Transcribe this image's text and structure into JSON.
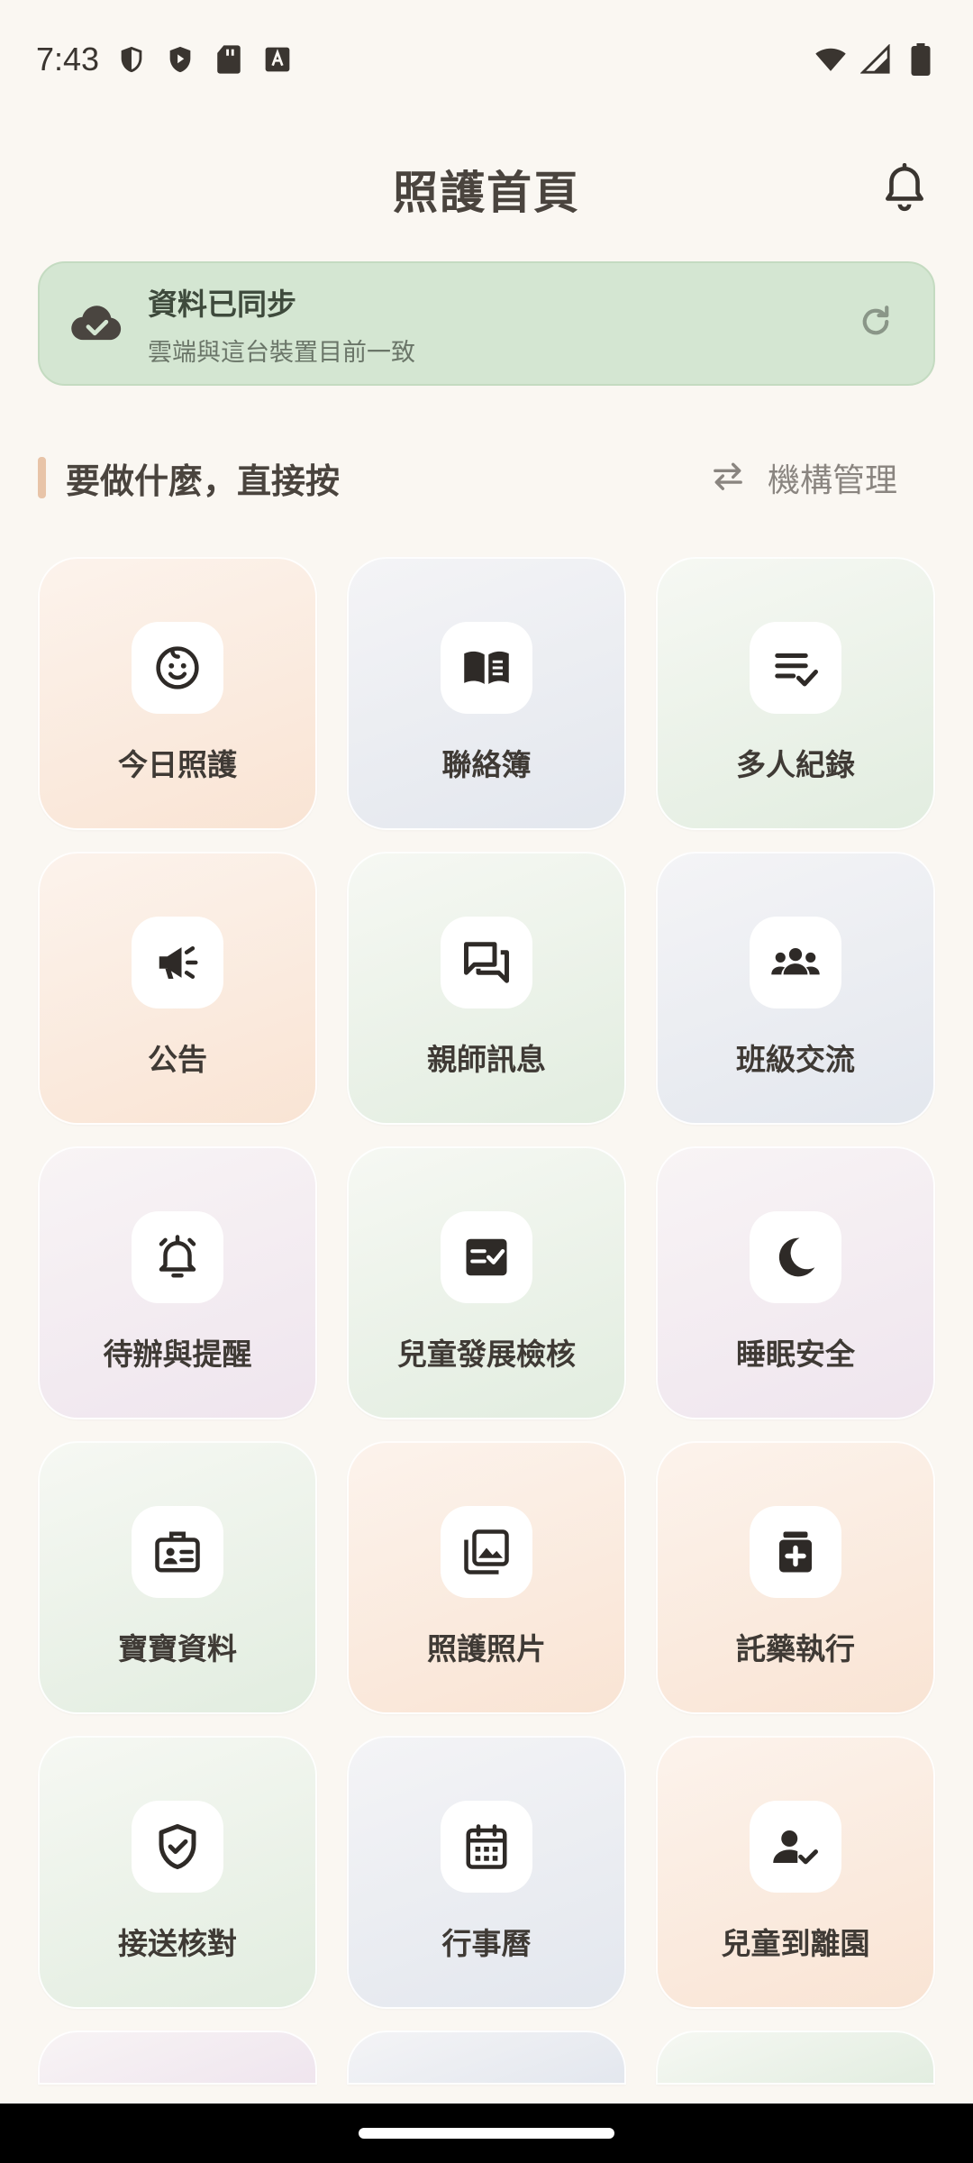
{
  "status_bar": {
    "time": "7:43",
    "left_icons": [
      "shield-icon",
      "play-shield-icon",
      "sd-card-icon",
      "font-icon"
    ],
    "right_icons": [
      "wifi-icon",
      "signal-icon",
      "battery-icon"
    ]
  },
  "header": {
    "title": "照護首頁",
    "bell_icon": "bell-icon"
  },
  "sync": {
    "title": "資料已同步",
    "subtitle": "雲端與這台裝置目前一致",
    "cloud_icon": "cloud-check-icon",
    "refresh_icon": "refresh-icon"
  },
  "section": {
    "title": "要做什麼，直接按",
    "org_label": "機構管理",
    "org_icon": "swap-arrows-icon"
  },
  "tiles": [
    {
      "label": "今日照護",
      "icon": "baby-face-icon",
      "color": "#F9E4D4"
    },
    {
      "label": "聯絡簿",
      "icon": "open-book-icon",
      "color": "#E3E7EE"
    },
    {
      "label": "多人紀錄",
      "icon": "checklist-icon",
      "color": "#E2EDE0"
    },
    {
      "label": "公告",
      "icon": "megaphone-icon",
      "color": "#F9E4D4"
    },
    {
      "label": "親師訊息",
      "icon": "chat-bubbles-icon",
      "color": "#E2EDE0"
    },
    {
      "label": "班級交流",
      "icon": "group-icon",
      "color": "#E3E7EE"
    },
    {
      "label": "待辦與提醒",
      "icon": "alarm-bell-icon",
      "color": "#EFE5EE"
    },
    {
      "label": "兒童發展檢核",
      "icon": "checkbox-list-icon",
      "color": "#E2EDE0"
    },
    {
      "label": "睡眠安全",
      "icon": "moon-icon",
      "color": "#EFE5EE"
    },
    {
      "label": "寶寶資料",
      "icon": "id-badge-icon",
      "color": "#E2EDE0"
    },
    {
      "label": "照護照片",
      "icon": "photo-library-icon",
      "color": "#F9E4D4"
    },
    {
      "label": "託藥執行",
      "icon": "medication-icon",
      "color": "#F9E4D4"
    },
    {
      "label": "接送核對",
      "icon": "shield-check-icon",
      "color": "#E2EDE0"
    },
    {
      "label": "行事曆",
      "icon": "calendar-icon",
      "color": "#E3E7EE"
    },
    {
      "label": "兒童到離園",
      "icon": "person-check-icon",
      "color": "#F9E4D4"
    }
  ]
}
